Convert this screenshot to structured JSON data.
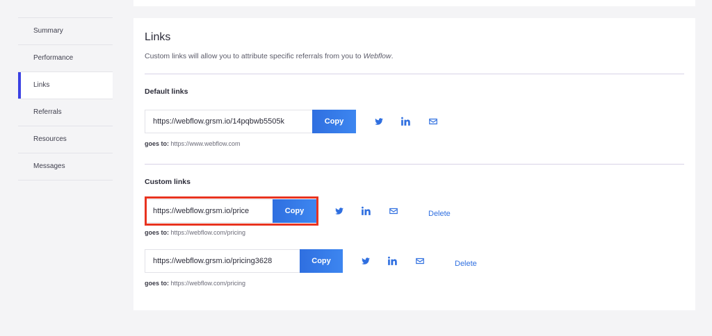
{
  "sidebar": {
    "items": [
      {
        "label": "Summary"
      },
      {
        "label": "Performance"
      },
      {
        "label": "Links"
      },
      {
        "label": "Referrals"
      },
      {
        "label": "Resources"
      },
      {
        "label": "Messages"
      }
    ],
    "active_index": 2
  },
  "links_page": {
    "title": "Links",
    "subtitle_prefix": "Custom links will allow you to attribute specific referrals from you to ",
    "subtitle_brand": "Webflow",
    "subtitle_suffix": ".",
    "default_heading": "Default links",
    "custom_heading": "Custom links",
    "goes_to_label": "goes to:",
    "copy_label": "Copy",
    "delete_label": "Delete",
    "default_links": [
      {
        "url": "https://webflow.grsm.io/14pqbwb5505k",
        "goes_to": "https://www.webflow.com"
      }
    ],
    "custom_links": [
      {
        "url": "https://webflow.grsm.io/price",
        "goes_to": "https://webflow.com/pricing"
      },
      {
        "url": "https://webflow.grsm.io/pricing3628",
        "goes_to": "https://webflow.com/pricing"
      }
    ]
  },
  "icons": {
    "share": [
      "twitter-icon",
      "linkedin-icon",
      "email-icon"
    ]
  },
  "colors": {
    "accent": "#2f6fe0",
    "sidebar_active": "#3b41e3",
    "highlight": "#e8331f"
  }
}
